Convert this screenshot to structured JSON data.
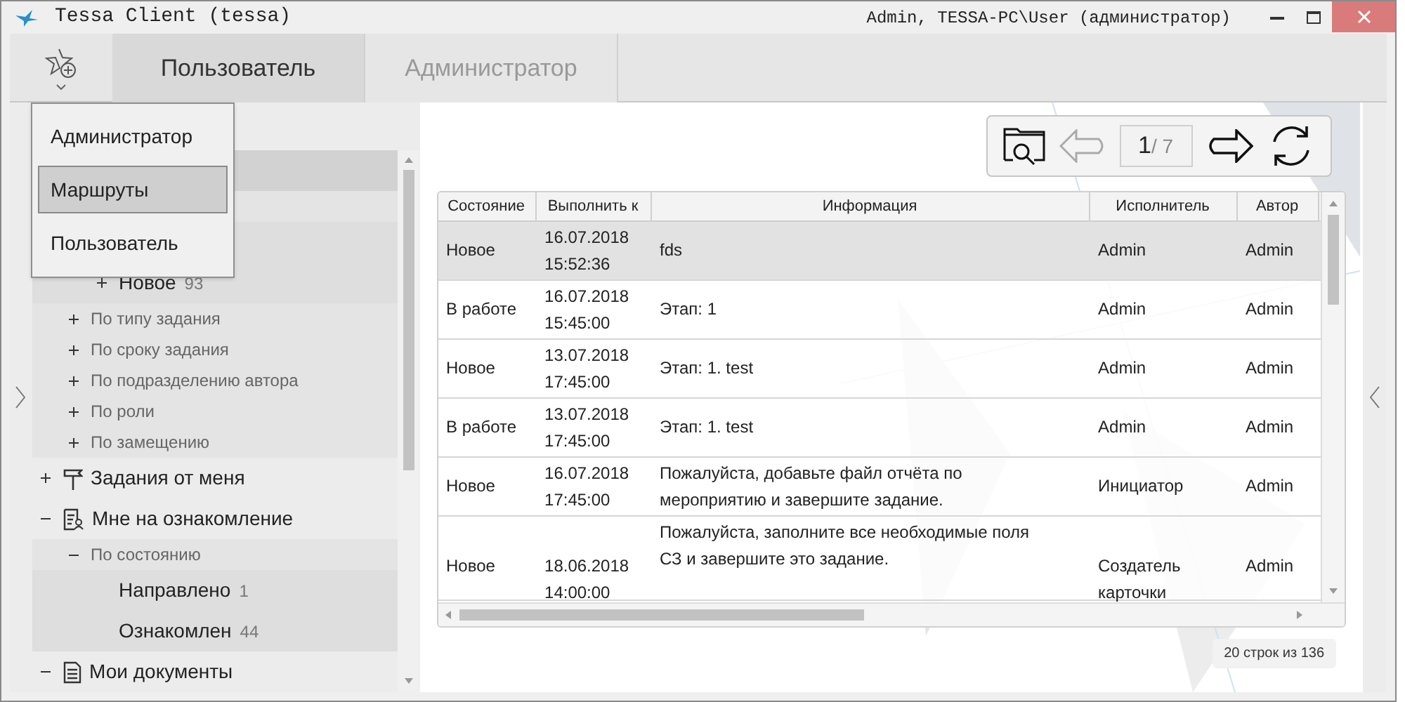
{
  "window": {
    "title": "Tessa Client (tessa)",
    "user": "Admin, TESSA-PC\\User (администратор)"
  },
  "tabs": [
    {
      "label": "Пользователь",
      "selected": true
    },
    {
      "label": "Администратор",
      "selected": false
    }
  ],
  "workplace_menu": [
    {
      "label": "Администратор",
      "selected": false
    },
    {
      "label": "Маршруты",
      "selected": true
    },
    {
      "label": "Пользователь",
      "selected": false
    }
  ],
  "tree": [
    {
      "kind": "group",
      "selected": true,
      "children": [
        {
          "kind": "filter",
          "children": [
            {
              "kind": "state"
            },
            {
              "kind": "state",
              "label": "Новое",
              "count": "93",
              "expanded": false
            }
          ]
        },
        {
          "kind": "filter",
          "label": "По типу задания",
          "expanded": false
        },
        {
          "kind": "filter",
          "label": "По сроку задания",
          "expanded": false
        },
        {
          "kind": "filter",
          "label": "По подразделению автора",
          "expanded": false
        },
        {
          "kind": "filter",
          "label": "По роли",
          "expanded": false
        },
        {
          "kind": "filter",
          "label": "По замещению",
          "expanded": false
        }
      ]
    },
    {
      "kind": "group",
      "label": "Задания от меня",
      "expanded": false,
      "selected": false
    },
    {
      "kind": "group",
      "label": "Мне на ознакомление",
      "expanded": true,
      "selected": false,
      "children": [
        {
          "kind": "filter",
          "label": "По состоянию",
          "expanded": true,
          "children": [
            {
              "kind": "state",
              "label": "Направлено",
              "count": "1"
            },
            {
              "kind": "state",
              "label": "Ознакомлен",
              "count": "44"
            }
          ]
        }
      ]
    },
    {
      "kind": "group",
      "label": "Мои документы",
      "expanded": true,
      "selected": false
    }
  ],
  "pager": {
    "current": "1",
    "total": "/ 7",
    "prev_disabled": true,
    "next_disabled": false
  },
  "table": {
    "columns": [
      "Состояние",
      "Выполнить к",
      "Информация",
      "Исполнитель",
      "Автор"
    ],
    "rows": [
      {
        "selected": true,
        "cells": [
          "Новое",
          "16.07.2018\n15:52:36",
          "fds",
          "Admin",
          "Admin"
        ]
      },
      {
        "selected": false,
        "cells": [
          "В работе",
          "16.07.2018\n15:45:00",
          "Этап: 1",
          "Admin",
          "Admin"
        ]
      },
      {
        "selected": false,
        "cells": [
          "Новое",
          "13.07.2018\n17:45:00",
          "Этап: 1. test",
          "Admin",
          "Admin"
        ]
      },
      {
        "selected": false,
        "cells": [
          "В работе",
          "13.07.2018\n17:45:00",
          "Этап: 1. test",
          "Admin",
          "Admin"
        ]
      },
      {
        "selected": false,
        "cells": [
          "Новое",
          "16.07.2018\n17:45:00",
          "Пожалуйста, добавьте файл отчёта по мероприятию и завершите задание.",
          "Инициатор",
          "Admin"
        ]
      },
      {
        "selected": false,
        "cells": [
          "Новое",
          "18.06.2018\n14:00:00",
          "Пожалуйста, заполните все необходимые поля СЗ и завершите это задание.",
          "Создатель карточки",
          "Admin"
        ]
      }
    ]
  },
  "footer": "20 строк из 136"
}
